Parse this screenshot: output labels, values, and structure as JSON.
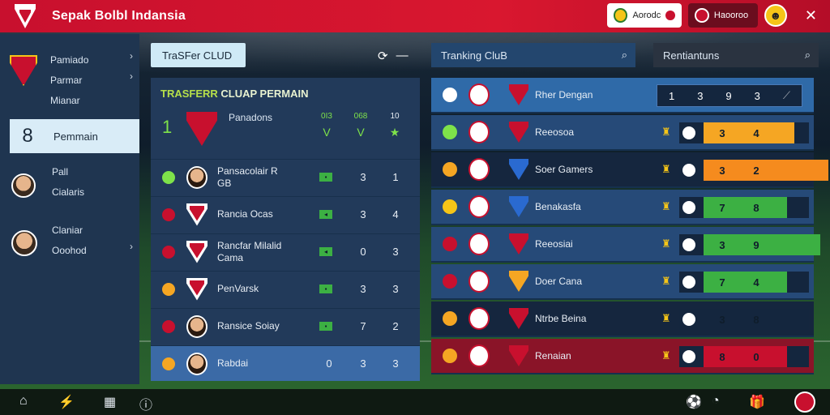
{
  "app": {
    "title": "Sepak Bolbl Indansia"
  },
  "topbar": {
    "pill_white_label": "Aorodc",
    "pill_dark_label": "Haooroo",
    "close_symbol": "✕"
  },
  "sidebar": {
    "items": [
      {
        "lines": [
          "Pamiado",
          "Parmar",
          "Mianar"
        ]
      },
      {
        "lines": [
          "Pemmain"
        ]
      },
      {
        "lines": [
          "Pall",
          "Cialaris"
        ]
      },
      {
        "lines": [
          "Claniar",
          "Ooohod"
        ]
      }
    ],
    "active_glyph": "8"
  },
  "middle": {
    "tab_label": "TraSFer CLUD",
    "title_prefix": "TRASFERR",
    "title_rest": " CLUAP PERMAIN",
    "header": {
      "rank": "1",
      "label": "Panadons",
      "cols": [
        {
          "top": "0I3",
          "sym": "V"
        },
        {
          "top": "068",
          "sym": "V"
        },
        {
          "top": "10",
          "sym": "★"
        }
      ]
    },
    "rows": [
      {
        "name": "Pansacolair R\nGB",
        "flag": "▪",
        "v1": "3",
        "v2": "1",
        "icon_color": "#7ee24a",
        "img": "face"
      },
      {
        "name": "Rancia Ocas",
        "flag": "◂",
        "v1": "3",
        "v2": "4",
        "icon_color": "#c8102e",
        "img": "crest"
      },
      {
        "name": "Rancfar Milalid\nCama",
        "flag": "◂",
        "v1": "0",
        "v2": "3",
        "icon_color": "#c8102e",
        "img": "crest"
      },
      {
        "name": "PenVarsk",
        "flag": "▪",
        "v1": "3",
        "v2": "3",
        "icon_color": "#f5a623",
        "img": "crest"
      },
      {
        "name": "Ransice Soiay",
        "flag": "▪",
        "v1": "7",
        "v2": "2",
        "icon_color": "#c8102e",
        "img": "face"
      },
      {
        "name": "Rabdai",
        "flag": "",
        "v1": "3",
        "v2": "3",
        "v0": "0",
        "icon_color": "#f5a623",
        "img": "face"
      }
    ]
  },
  "ranking": {
    "search1_label": "Tranking CluB",
    "search2_label": "Rentiantuns",
    "rows": [
      {
        "name": "Rher Dengan",
        "cells": [
          "1",
          "3",
          "9",
          "3"
        ],
        "style": "hl",
        "icon_color": "#ffffff"
      },
      {
        "name": "Reeosoa",
        "v1": "3",
        "v2": "4",
        "fill_color": "#f5a623",
        "fill_ratio": 0.68,
        "style": "",
        "icon_color": "#7ee24a"
      },
      {
        "name": "Soer Gamers",
        "v1": "3",
        "v2": "2",
        "fill_color": "#f58b1e",
        "fill_ratio": 0.94,
        "style": "dark",
        "icon_color": "#f5a623"
      },
      {
        "name": "Benakasfa",
        "v1": "7",
        "v2": "8",
        "fill_color": "#3cb043",
        "fill_ratio": 0.63,
        "style": "",
        "icon_color": "#f5c518"
      },
      {
        "name": "Reeosiai",
        "v1": "3",
        "v2": "9",
        "fill_color": "#3cb043",
        "fill_ratio": 0.88,
        "style": "",
        "icon_color": "#c8102e"
      },
      {
        "name": "Doer Cana",
        "v1": "7",
        "v2": "4",
        "fill_color": "#3cb043",
        "fill_ratio": 0.63,
        "style": "",
        "icon_color": "#c8102e"
      },
      {
        "name": "Ntrbe Beina",
        "v1": "3",
        "v2": "8",
        "fill_color": "#14263e",
        "fill_ratio": 0.0,
        "style": "dark",
        "icon_color": "#f5a623"
      },
      {
        "name": "Renaian",
        "v1": "8",
        "v2": "0",
        "fill_color": "#c8102e",
        "fill_ratio": 0.63,
        "style": "red",
        "icon_color": "#f5a623"
      }
    ]
  },
  "bottombar": {
    "home_icon": "⌂",
    "nav_icon": "⚡",
    "grid_icon": "▦",
    "info_icon": "ⓘ",
    "ball_icon": "⚽",
    "helmet_icon": "◔",
    "gift_icon": "🎁"
  }
}
